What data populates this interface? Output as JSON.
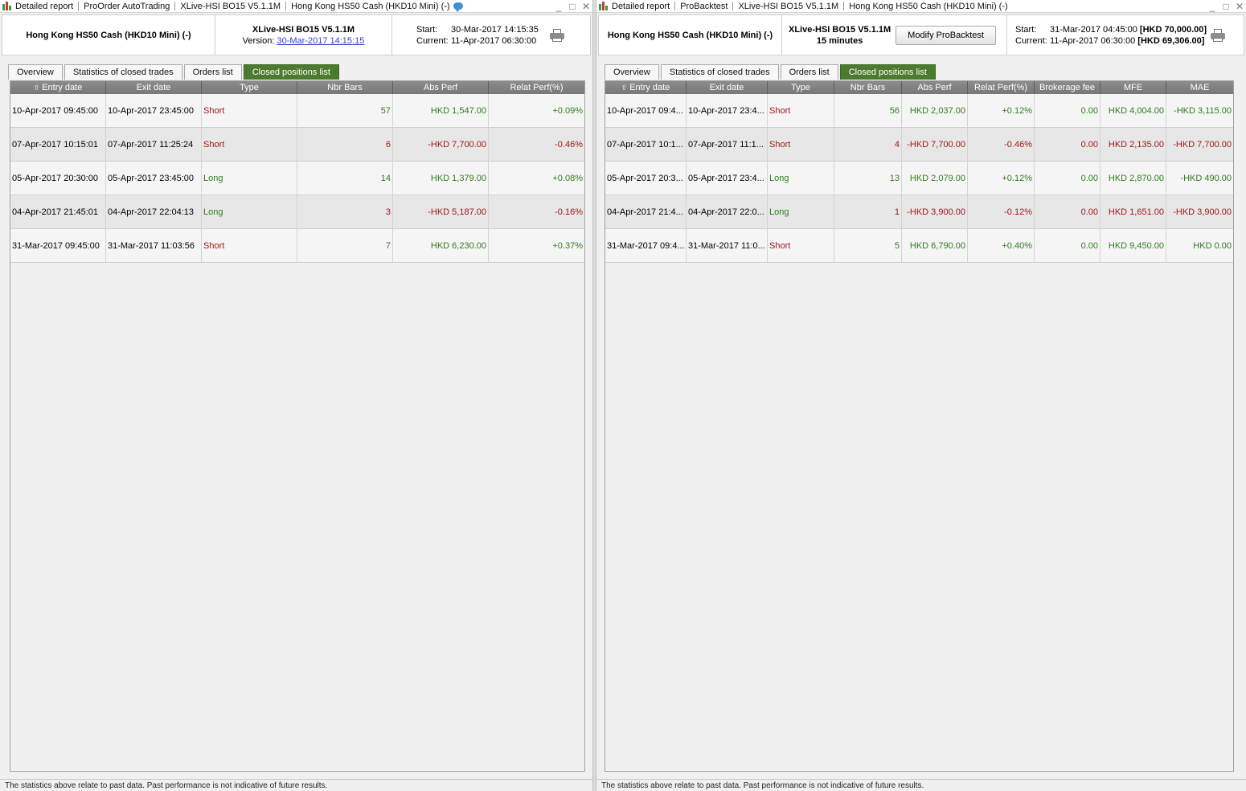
{
  "left": {
    "breadcrumbs": [
      "Detailed report",
      "ProOrder AutoTrading",
      "XLive-HSI BO15 V5.1.1M",
      "Hong Kong HS50 Cash (HKD10 Mini) (-)"
    ],
    "window_controls": {
      "minimize": "_",
      "maximize": "□",
      "close": "✕"
    },
    "instrument": "Hong Kong HS50 Cash (HKD10 Mini) (-)",
    "strategy_name": "XLive-HSI BO15 V5.1.1M",
    "version_label": "Version:",
    "version_link": "30-Mar-2017 14:15:15",
    "start_label": "Start:",
    "start_value": "30-Mar-2017 14:15:35",
    "current_label": "Current:",
    "current_value": "11-Apr-2017 06:30:00",
    "tabs": [
      "Overview",
      "Statistics of closed trades",
      "Orders list",
      "Closed positions list"
    ],
    "active_tab": 3,
    "columns": [
      "Entry date",
      "Exit date",
      "Type",
      "Nbr Bars",
      "Abs Perf",
      "Relat Perf(%)"
    ],
    "rows": [
      {
        "entry": "10-Apr-2017 09:45:00",
        "exit": "10-Apr-2017 23:45:00",
        "type": "Short",
        "bars": "57",
        "abs": "HKD 1,547.00",
        "rel": "+0.09%"
      },
      {
        "entry": "07-Apr-2017 10:15:01",
        "exit": "07-Apr-2017 11:25:24",
        "type": "Short",
        "bars": "6",
        "abs": "-HKD 7,700.00",
        "rel": "-0.46%"
      },
      {
        "entry": "05-Apr-2017 20:30:00",
        "exit": "05-Apr-2017 23:45:00",
        "type": "Long",
        "bars": "14",
        "abs": "HKD 1,379.00",
        "rel": "+0.08%"
      },
      {
        "entry": "04-Apr-2017 21:45:01",
        "exit": "04-Apr-2017 22:04:13",
        "type": "Long",
        "bars": "3",
        "abs": "-HKD 5,187.00",
        "rel": "-0.16%"
      },
      {
        "entry": "31-Mar-2017 09:45:00",
        "exit": "31-Mar-2017 11:03:56",
        "type": "Short",
        "bars": "7",
        "abs": "HKD 6,230.00",
        "rel": "+0.37%"
      }
    ],
    "footer": "The statistics above relate to past data. Past performance is not indicative of future results."
  },
  "right": {
    "breadcrumbs": [
      "Detailed report",
      "ProBacktest",
      "XLive-HSI BO15 V5.1.1M",
      "Hong Kong HS50 Cash (HKD10 Mini) (-)"
    ],
    "window_controls": {
      "minimize": "_",
      "maximize": "□",
      "close": "✕"
    },
    "instrument": "Hong Kong HS50 Cash (HKD10 Mini) (-)",
    "strategy_name": "XLive-HSI BO15 V5.1.1M",
    "timeframe": "15 minutes",
    "modify_button": "Modify ProBacktest",
    "start_label": "Start:",
    "start_value": "31-Mar-2017 04:45:00",
    "start_capital": "[HKD 70,000.00]",
    "current_label": "Current:",
    "current_value": "11-Apr-2017 06:30:00",
    "current_capital": "[HKD 69,306.00]",
    "tabs": [
      "Overview",
      "Statistics of closed trades",
      "Orders list",
      "Closed positions list"
    ],
    "active_tab": 3,
    "columns": [
      "Entry date",
      "Exit date",
      "Type",
      "Nbr Bars",
      "Abs Perf",
      "Relat Perf(%)",
      "Brokerage fee",
      "MFE",
      "MAE"
    ],
    "rows": [
      {
        "entry": "10-Apr-2017 09:4...",
        "exit": "10-Apr-2017 23:4...",
        "type": "Short",
        "bars": "56",
        "abs": "HKD 2,037.00",
        "rel": "+0.12%",
        "fee": "0.00",
        "mfe": "HKD 4,004.00",
        "mae": "-HKD 3,115.00"
      },
      {
        "entry": "07-Apr-2017 10:1...",
        "exit": "07-Apr-2017 11:1...",
        "type": "Short",
        "bars": "4",
        "abs": "-HKD 7,700.00",
        "rel": "-0.46%",
        "fee": "0.00",
        "mfe": "HKD 2,135.00",
        "mae": "-HKD 7,700.00"
      },
      {
        "entry": "05-Apr-2017 20:3...",
        "exit": "05-Apr-2017 23:4...",
        "type": "Long",
        "bars": "13",
        "abs": "HKD 2,079.00",
        "rel": "+0.12%",
        "fee": "0.00",
        "mfe": "HKD 2,870.00",
        "mae": "-HKD 490.00"
      },
      {
        "entry": "04-Apr-2017 21:4...",
        "exit": "04-Apr-2017 22:0...",
        "type": "Long",
        "bars": "1",
        "abs": "-HKD 3,900.00",
        "rel": "-0.12%",
        "fee": "0.00",
        "mfe": "HKD 1,651.00",
        "mae": "-HKD 3,900.00"
      },
      {
        "entry": "31-Mar-2017 09:4...",
        "exit": "31-Mar-2017 11:0...",
        "type": "Short",
        "bars": "5",
        "abs": "HKD 6,790.00",
        "rel": "+0.40%",
        "fee": "0.00",
        "mfe": "HKD 9,450.00",
        "mae": "HKD 0.00"
      }
    ],
    "footer": "The statistics above relate to past data. Past performance is not indicative of future results."
  },
  "colors": {
    "positive": "#2e7d1e",
    "negative": "#a01818",
    "active_tab": "#4c7a2f",
    "header_bg": "#808080",
    "link": "#3344cc"
  },
  "icons": {
    "app": "candlestick-chart-icon",
    "chat": "chat-bubble-icon",
    "print": "printer-icon",
    "sort": "sort-arrow-up-icon"
  }
}
